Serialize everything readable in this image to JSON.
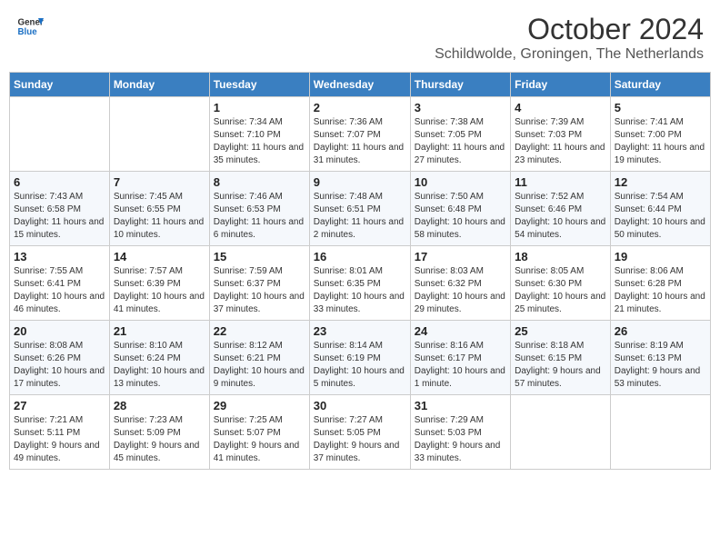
{
  "header": {
    "logo_general": "General",
    "logo_blue": "Blue",
    "month_title": "October 2024",
    "subtitle": "Schildwolde, Groningen, The Netherlands"
  },
  "days_of_week": [
    "Sunday",
    "Monday",
    "Tuesday",
    "Wednesday",
    "Thursday",
    "Friday",
    "Saturday"
  ],
  "weeks": [
    [
      {
        "day": "",
        "info": ""
      },
      {
        "day": "",
        "info": ""
      },
      {
        "day": "1",
        "info": "Sunrise: 7:34 AM\nSunset: 7:10 PM\nDaylight: 11 hours and 35 minutes."
      },
      {
        "day": "2",
        "info": "Sunrise: 7:36 AM\nSunset: 7:07 PM\nDaylight: 11 hours and 31 minutes."
      },
      {
        "day": "3",
        "info": "Sunrise: 7:38 AM\nSunset: 7:05 PM\nDaylight: 11 hours and 27 minutes."
      },
      {
        "day": "4",
        "info": "Sunrise: 7:39 AM\nSunset: 7:03 PM\nDaylight: 11 hours and 23 minutes."
      },
      {
        "day": "5",
        "info": "Sunrise: 7:41 AM\nSunset: 7:00 PM\nDaylight: 11 hours and 19 minutes."
      }
    ],
    [
      {
        "day": "6",
        "info": "Sunrise: 7:43 AM\nSunset: 6:58 PM\nDaylight: 11 hours and 15 minutes."
      },
      {
        "day": "7",
        "info": "Sunrise: 7:45 AM\nSunset: 6:55 PM\nDaylight: 11 hours and 10 minutes."
      },
      {
        "day": "8",
        "info": "Sunrise: 7:46 AM\nSunset: 6:53 PM\nDaylight: 11 hours and 6 minutes."
      },
      {
        "day": "9",
        "info": "Sunrise: 7:48 AM\nSunset: 6:51 PM\nDaylight: 11 hours and 2 minutes."
      },
      {
        "day": "10",
        "info": "Sunrise: 7:50 AM\nSunset: 6:48 PM\nDaylight: 10 hours and 58 minutes."
      },
      {
        "day": "11",
        "info": "Sunrise: 7:52 AM\nSunset: 6:46 PM\nDaylight: 10 hours and 54 minutes."
      },
      {
        "day": "12",
        "info": "Sunrise: 7:54 AM\nSunset: 6:44 PM\nDaylight: 10 hours and 50 minutes."
      }
    ],
    [
      {
        "day": "13",
        "info": "Sunrise: 7:55 AM\nSunset: 6:41 PM\nDaylight: 10 hours and 46 minutes."
      },
      {
        "day": "14",
        "info": "Sunrise: 7:57 AM\nSunset: 6:39 PM\nDaylight: 10 hours and 41 minutes."
      },
      {
        "day": "15",
        "info": "Sunrise: 7:59 AM\nSunset: 6:37 PM\nDaylight: 10 hours and 37 minutes."
      },
      {
        "day": "16",
        "info": "Sunrise: 8:01 AM\nSunset: 6:35 PM\nDaylight: 10 hours and 33 minutes."
      },
      {
        "day": "17",
        "info": "Sunrise: 8:03 AM\nSunset: 6:32 PM\nDaylight: 10 hours and 29 minutes."
      },
      {
        "day": "18",
        "info": "Sunrise: 8:05 AM\nSunset: 6:30 PM\nDaylight: 10 hours and 25 minutes."
      },
      {
        "day": "19",
        "info": "Sunrise: 8:06 AM\nSunset: 6:28 PM\nDaylight: 10 hours and 21 minutes."
      }
    ],
    [
      {
        "day": "20",
        "info": "Sunrise: 8:08 AM\nSunset: 6:26 PM\nDaylight: 10 hours and 17 minutes."
      },
      {
        "day": "21",
        "info": "Sunrise: 8:10 AM\nSunset: 6:24 PM\nDaylight: 10 hours and 13 minutes."
      },
      {
        "day": "22",
        "info": "Sunrise: 8:12 AM\nSunset: 6:21 PM\nDaylight: 10 hours and 9 minutes."
      },
      {
        "day": "23",
        "info": "Sunrise: 8:14 AM\nSunset: 6:19 PM\nDaylight: 10 hours and 5 minutes."
      },
      {
        "day": "24",
        "info": "Sunrise: 8:16 AM\nSunset: 6:17 PM\nDaylight: 10 hours and 1 minute."
      },
      {
        "day": "25",
        "info": "Sunrise: 8:18 AM\nSunset: 6:15 PM\nDaylight: 9 hours and 57 minutes."
      },
      {
        "day": "26",
        "info": "Sunrise: 8:19 AM\nSunset: 6:13 PM\nDaylight: 9 hours and 53 minutes."
      }
    ],
    [
      {
        "day": "27",
        "info": "Sunrise: 7:21 AM\nSunset: 5:11 PM\nDaylight: 9 hours and 49 minutes."
      },
      {
        "day": "28",
        "info": "Sunrise: 7:23 AM\nSunset: 5:09 PM\nDaylight: 9 hours and 45 minutes."
      },
      {
        "day": "29",
        "info": "Sunrise: 7:25 AM\nSunset: 5:07 PM\nDaylight: 9 hours and 41 minutes."
      },
      {
        "day": "30",
        "info": "Sunrise: 7:27 AM\nSunset: 5:05 PM\nDaylight: 9 hours and 37 minutes."
      },
      {
        "day": "31",
        "info": "Sunrise: 7:29 AM\nSunset: 5:03 PM\nDaylight: 9 hours and 33 minutes."
      },
      {
        "day": "",
        "info": ""
      },
      {
        "day": "",
        "info": ""
      }
    ]
  ]
}
